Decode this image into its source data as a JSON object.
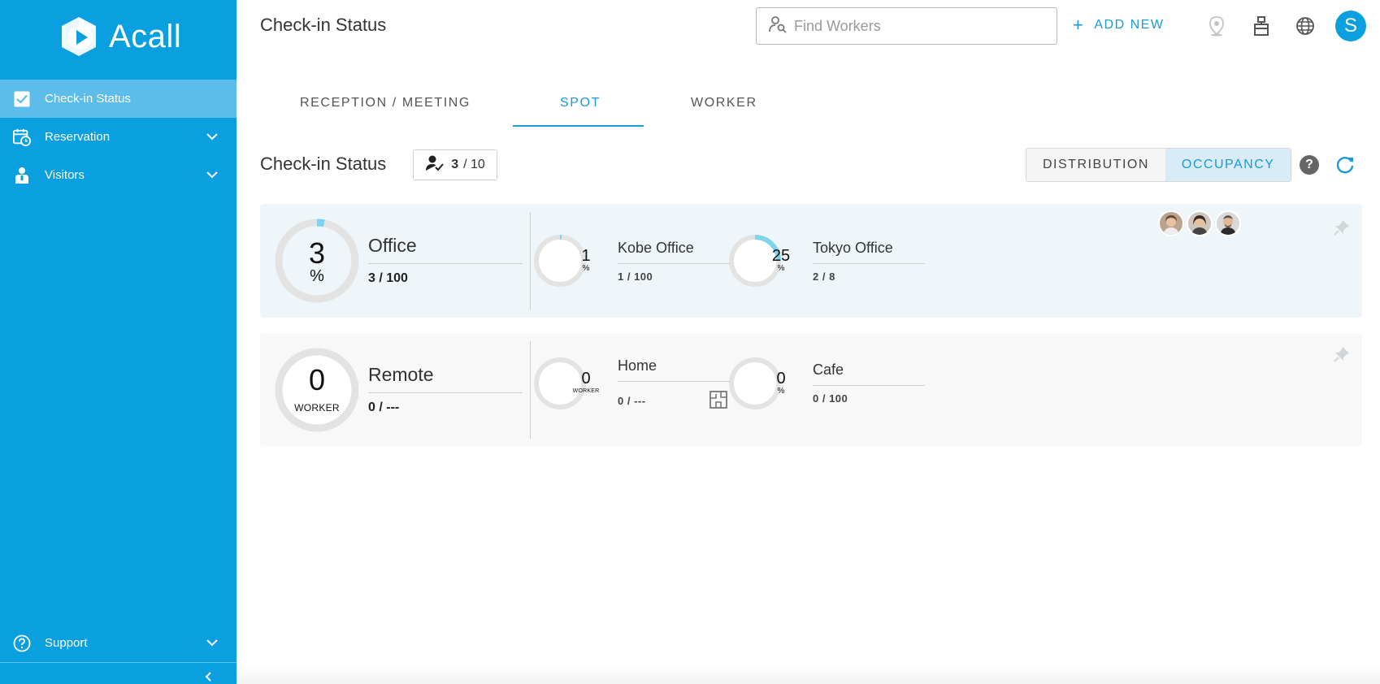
{
  "app": {
    "name": "Acall",
    "brand_color": "#0aa0e0",
    "accent_color": "#1a9ad6"
  },
  "sidebar": {
    "items": [
      {
        "label": "Check-in Status",
        "icon": "checkbox-icon",
        "active": true
      },
      {
        "label": "Reservation",
        "icon": "calendar-clock-icon",
        "expandable": true
      },
      {
        "label": "Visitors",
        "icon": "visitor-icon",
        "expandable": true
      }
    ],
    "support_label": "Support"
  },
  "header": {
    "title": "Check-in Status",
    "search_placeholder": "Find Workers",
    "add_new_label": "ADD NEW",
    "user_initial": "S"
  },
  "tabs": [
    {
      "label": "RECEPTION / MEETING",
      "active": false
    },
    {
      "label": "SPOT",
      "active": true
    },
    {
      "label": "WORKER",
      "active": false
    }
  ],
  "status_bar": {
    "title": "Check-in Status",
    "checked_in": "3",
    "total": "/ 10",
    "view_distribution": "DISTRIBUTION",
    "view_occupancy": "OCCUPANCY",
    "selected_view": "OCCUPANCY"
  },
  "groups": [
    {
      "name": "Office",
      "value": "3",
      "unit": "%",
      "count": "3 / 100",
      "fill": 0.03,
      "spots": [
        {
          "name": "Kobe Office",
          "value": "1",
          "unit": "%",
          "count": "1 / 100",
          "fill": 0.01
        },
        {
          "name": "Tokyo Office",
          "value": "25",
          "unit": "%",
          "count": "2 / 8",
          "fill": 0.25
        }
      ],
      "present_workers": 3
    },
    {
      "name": "Remote",
      "value": "0",
      "unit": "WORKER",
      "count": "0 / ---",
      "fill": 0,
      "spots": [
        {
          "name": "Home",
          "value": "0",
          "unit": "WORKER",
          "count": "0 / ---",
          "fill": 0
        },
        {
          "name": "Cafe",
          "value": "0",
          "unit": "%",
          "count": "0 / 100",
          "fill": 0
        }
      ]
    }
  ]
}
